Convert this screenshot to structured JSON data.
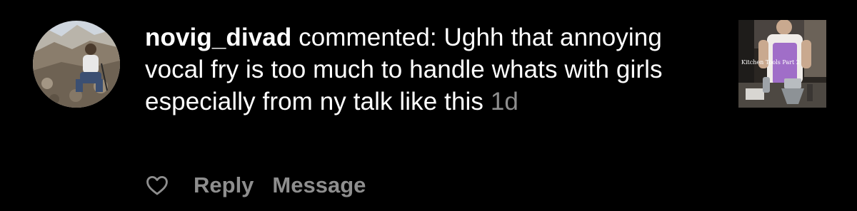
{
  "comment": {
    "username": "novig_divad",
    "text": " commented: Ughh that annoying vocal fry is too much to handle whats with girls especially from ny talk like this",
    "timestamp": "1d"
  },
  "thumbnail": {
    "caption": "Kitchen Tools Part 2"
  },
  "actions": {
    "like_icon": "heart-outline-icon",
    "reply_label": "Reply",
    "message_label": "Message"
  },
  "colors": {
    "background": "#000000",
    "primary_text": "#ffffff",
    "secondary_text": "#8e8e8e"
  }
}
